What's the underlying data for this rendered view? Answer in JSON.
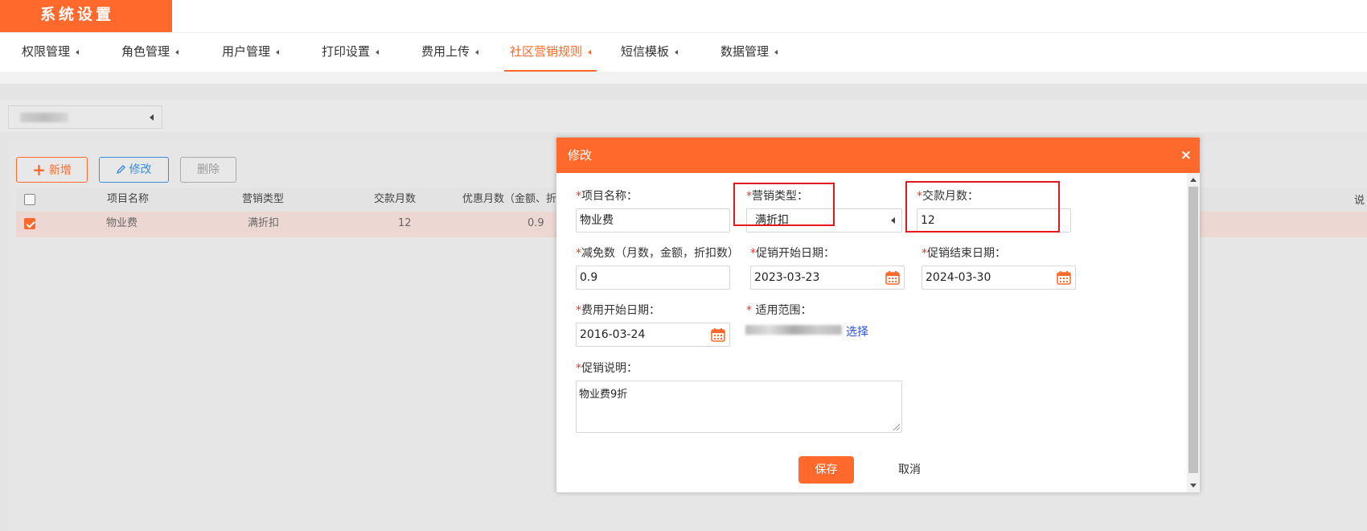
{
  "app": {
    "title": "系统设置"
  },
  "nav": {
    "tabs": [
      {
        "label": "权限管理"
      },
      {
        "label": "角色管理"
      },
      {
        "label": "用户管理"
      },
      {
        "label": "打印设置"
      },
      {
        "label": "费用上传"
      },
      {
        "label": "社区营销规则",
        "active": true
      },
      {
        "label": "短信模板"
      },
      {
        "label": "数据管理"
      }
    ]
  },
  "toolbar": {
    "add_label": "新增",
    "edit_label": "修改",
    "delete_label": "删除"
  },
  "table": {
    "columns": [
      "项目名称",
      "营销类型",
      "交款月数",
      "优惠月数（金额、折",
      "说"
    ],
    "rows": [
      {
        "name": "物业费",
        "type": "满折扣",
        "months": "12",
        "discount": "0.9",
        "checked": true
      }
    ]
  },
  "modal": {
    "title": "修改",
    "close_label": "×",
    "fields": {
      "project_name": {
        "label": "项目名称：",
        "value": "物业费"
      },
      "marketing_type": {
        "label": "营销类型：",
        "value": "满折扣"
      },
      "pay_months": {
        "label": "交款月数：",
        "value": "12"
      },
      "reduction": {
        "label": "减免数（月数，金额，折扣数）",
        "value": "0.9"
      },
      "promo_start": {
        "label": "促销开始日期：",
        "value": "2023-03-23"
      },
      "promo_end": {
        "label": "促销结束日期：",
        "value": "2024-03-30"
      },
      "fee_start": {
        "label": "费用开始日期：",
        "value": "2016-03-24"
      },
      "scope": {
        "label": " 适用范围：",
        "link": "选择"
      },
      "promo_desc": {
        "label": "促销说明：",
        "value": "物业费9折"
      }
    },
    "required_mark": "*",
    "save_label": "保存",
    "cancel_label": "取消"
  },
  "colors": {
    "accent": "#ff6a2c",
    "link": "#2a52d8",
    "highlight_box": "#e5161d"
  },
  "icons": [
    "caret-left-icon",
    "plus-icon",
    "pencil-icon",
    "calendar-icon",
    "close-icon"
  ]
}
